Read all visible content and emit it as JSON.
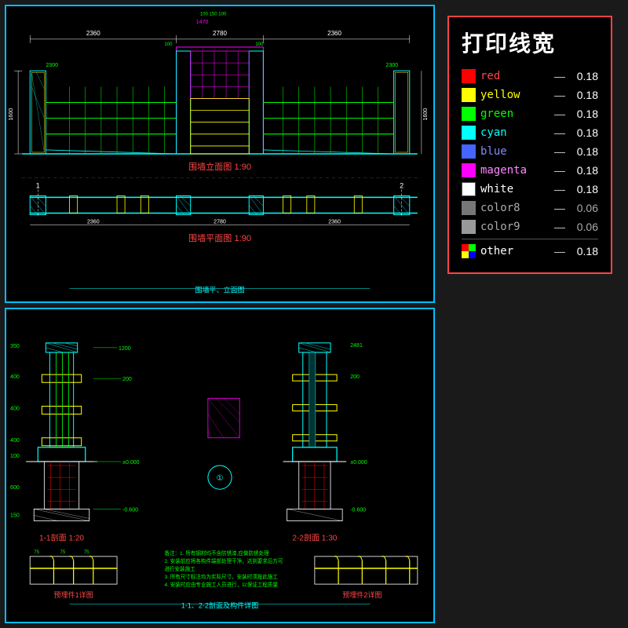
{
  "legend": {
    "title": "打印线宽",
    "items": [
      {
        "name": "red",
        "color": "#ff0000",
        "dash": "—",
        "value": "0.18",
        "type": "solid"
      },
      {
        "name": "yellow",
        "color": "#ffff00",
        "dash": "—",
        "value": "0.18",
        "type": "solid"
      },
      {
        "name": "green",
        "color": "#00ff00",
        "dash": "—",
        "value": "0.18",
        "type": "solid"
      },
      {
        "name": "cyan",
        "color": "#00ffff",
        "dash": "—",
        "value": "0.18",
        "type": "solid"
      },
      {
        "name": "blue",
        "color": "#0000ff",
        "dash": "—",
        "value": "0.18",
        "type": "solid"
      },
      {
        "name": "magenta",
        "color": "#ff00ff",
        "dash": "—",
        "value": "0.18",
        "type": "solid"
      },
      {
        "name": "white",
        "color": "#ffffff",
        "dash": "—",
        "value": "0.18",
        "type": "solid"
      },
      {
        "name": "color8",
        "color": "#888888",
        "dash": "—",
        "value": "0.06",
        "type": "solid"
      },
      {
        "name": "color9",
        "color": "#aaaaaa",
        "dash": "—",
        "value": "0.06",
        "type": "solid"
      },
      {
        "name": "other",
        "color": "multi",
        "dash": "—",
        "value": "0.18",
        "type": "multi"
      }
    ]
  },
  "drawings": {
    "top": {
      "label1": "围墙立面图 1:90",
      "label2": "围墙平面图 1:90",
      "footer": "围墙平、立面图"
    },
    "bottom": {
      "label1": "1-1剖面 1:20",
      "label2": "2-2剖面 1:30",
      "label3": "预埋件1详图",
      "label4": "预埋件2详图",
      "footer": "1-1、2-2剖面及构件详图"
    }
  }
}
